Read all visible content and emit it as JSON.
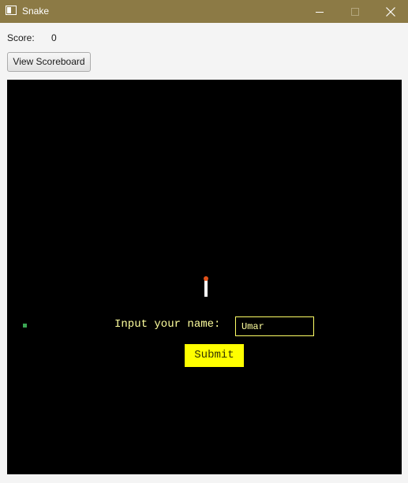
{
  "window": {
    "title": "Snake",
    "titlebar_color": "#8c7a45",
    "controls": [
      "minimize-icon",
      "maximize-icon",
      "close-icon"
    ]
  },
  "score": {
    "label": "Score:",
    "value": "0"
  },
  "toolbar": {
    "scoreboard_label": "View Scoreboard"
  },
  "game": {
    "background_color": "#000000",
    "snake_head_color": "#e2521a",
    "snake_body_color": "#ffffff",
    "food_color": "#3aa653",
    "name_prompt": "Input your name:",
    "name_value": "Umar",
    "submit_label": "Submit",
    "accent_color": "#ffff00"
  }
}
